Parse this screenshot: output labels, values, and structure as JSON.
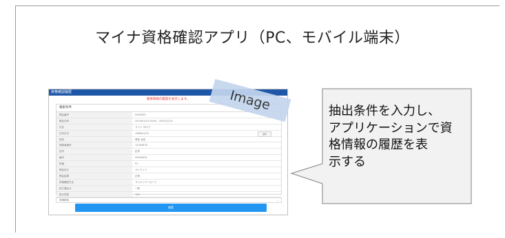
{
  "slide": {
    "title": "マイナ資格確認アプリ（PC、モバイル端末）"
  },
  "app_screenshot": {
    "header_title": "資格確認履歴",
    "alert": "資格情報の履歴を表示します。",
    "form_heading": "検索条件",
    "rows": [
      {
        "label": "照会番号",
        "value": "0000000"
      },
      {
        "label": "照会日時",
        "value": "2023/01/01 00:00 - 2023/12/31"
      },
      {
        "label": "氏名",
        "value": "マイナ タロウ"
      },
      {
        "label": "生年月日",
        "value": "1980/01/01",
        "button": "選択"
      },
      {
        "label": "性別",
        "value": "男性 女性"
      },
      {
        "label": "保険者番号",
        "value": "12345678"
      },
      {
        "label": "記号",
        "value": "記号"
      },
      {
        "label": "番号",
        "value": "00000001"
      },
      {
        "label": "枝番",
        "value": "01"
      },
      {
        "label": "照会区分",
        "value": "オンライン"
      },
      {
        "label": "照会結果",
        "value": "正常"
      },
      {
        "label": "資格確認方法",
        "value": "マイナンバーカード"
      },
      {
        "label": "処方箋区分",
        "value": "一般"
      },
      {
        "label": "表示件数",
        "value": "100"
      }
    ],
    "extra_label": "詳細検索",
    "search_button": "検索"
  },
  "image_tag": "Image",
  "callout": {
    "lines": [
      "抽出条件を入力し、",
      "アプリケーションで資",
      "格情報の履歴を表",
      "示する"
    ]
  },
  "colors": {
    "app_header": "#1f57a8",
    "alert_text": "#e53935",
    "search_button": "#2196f3",
    "image_tag_bg": "#c3d5ee",
    "callout_bg": "#f2f2f2"
  }
}
